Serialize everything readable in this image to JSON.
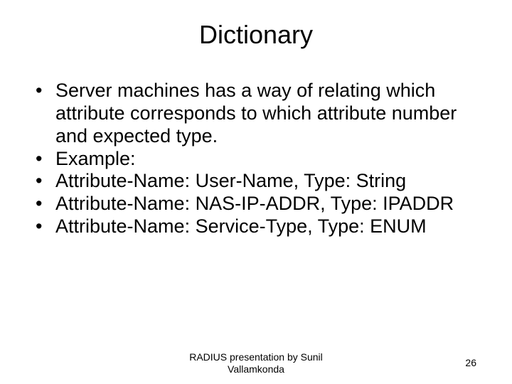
{
  "slide": {
    "title": "Dictionary",
    "bullets": [
      "Server machines has a way of relating which attribute corresponds to which attribute number and expected type.",
      "Example:",
      "Attribute-Name: User-Name, Type: String",
      "Attribute-Name: NAS-IP-ADDR, Type: IPADDR",
      "Attribute-Name: Service-Type, Type: ENUM"
    ],
    "footer": "RADIUS presentation by Sunil Vallamkonda",
    "page_number": "26"
  }
}
